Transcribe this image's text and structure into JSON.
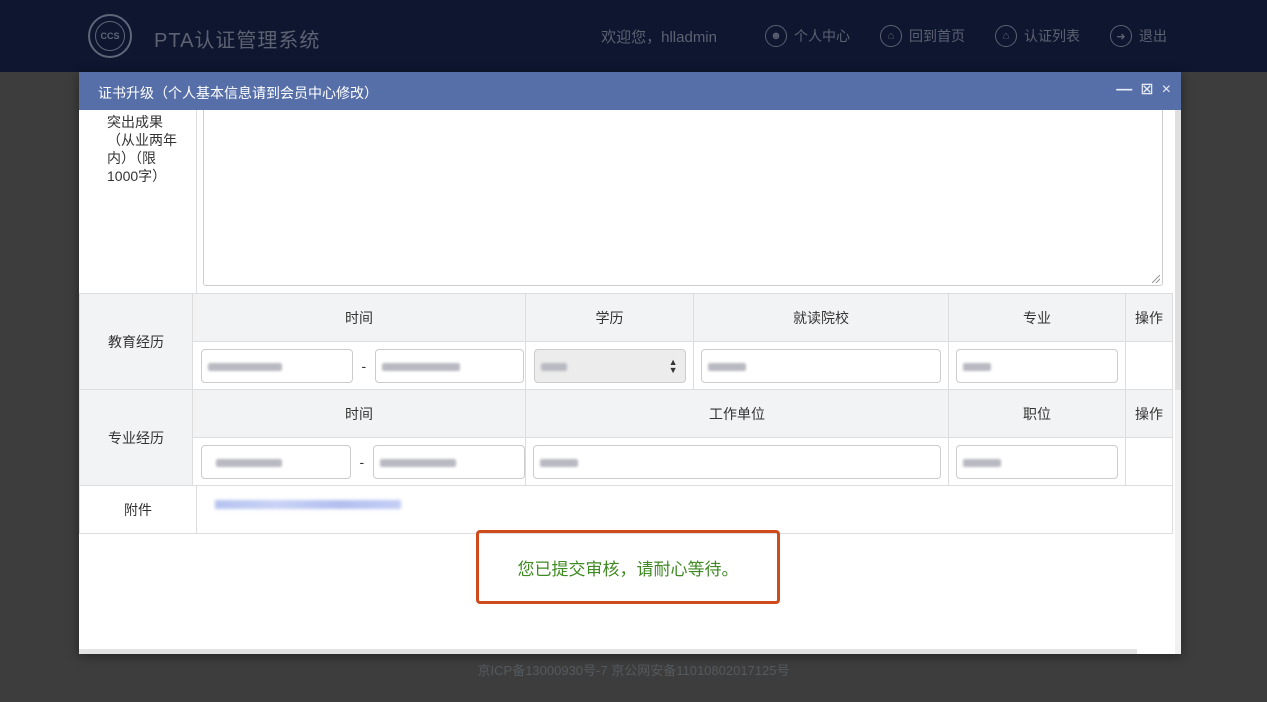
{
  "navbar": {
    "logo_text": "CCS",
    "brand": "PTA认证管理系统",
    "welcome": "欢迎您，hlladmin",
    "links": [
      {
        "label": "个人中心",
        "icon": "user-icon"
      },
      {
        "label": "回到首页",
        "icon": "home-icon"
      },
      {
        "label": "认证列表",
        "icon": "home-icon"
      },
      {
        "label": "退出",
        "icon": "logout-icon"
      }
    ]
  },
  "footer": {
    "icp": "京ICP备13000930号-7 京公网安备11010802017125号"
  },
  "modal": {
    "title": "证书升级（个人基本信息请到会员中心修改）",
    "tools": {
      "minimize": "—",
      "maximize": "⊠",
      "close": "×"
    },
    "outcome": {
      "label": "突出成果（从业两年内）（限1000字）",
      "value": ""
    },
    "education": {
      "label": "教育经历",
      "headers": [
        "时间",
        "学历",
        "就读院校",
        "专业",
        "操作"
      ],
      "dash": "-"
    },
    "professional": {
      "label": "专业经历",
      "headers": [
        "时间",
        "工作单位",
        "职位",
        "操作"
      ],
      "dash": "-"
    },
    "attachment": {
      "label": "附件"
    },
    "notice": "您已提交审核，请耐心等待。"
  },
  "colors": {
    "navbar_bg": "#0e1630",
    "modal_header": "#566fa8",
    "notice_border": "#cf4b1c",
    "notice_text": "#3f8a22"
  }
}
